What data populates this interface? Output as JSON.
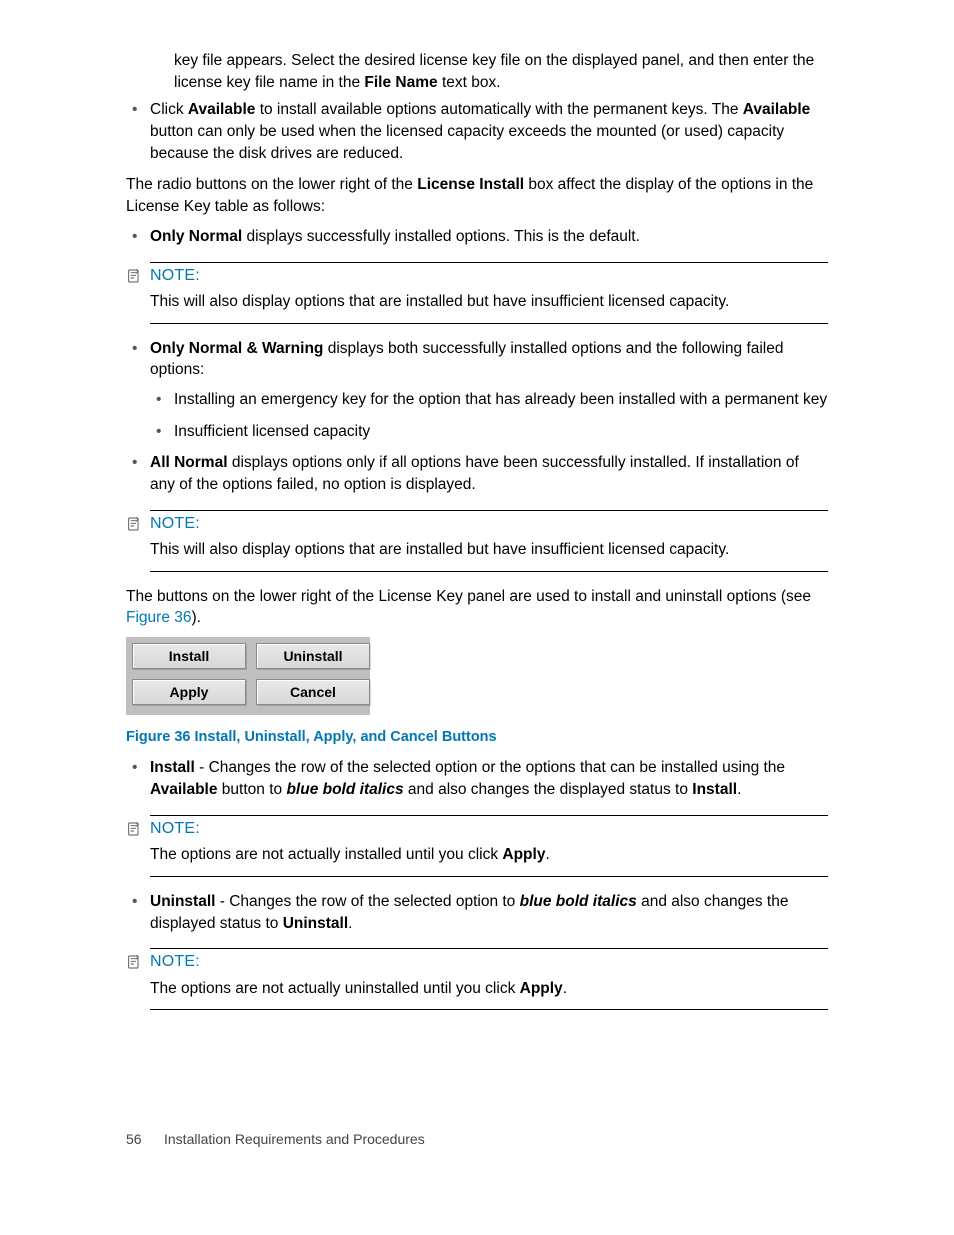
{
  "intro": {
    "frag1": "key file appears. Select the desired license key file on the displayed panel, and then enter the license key file name in the ",
    "frag1_bold": "File Name",
    "frag1_after": " text box.",
    "click_li_pre": "Click ",
    "click_li_b1": "Available",
    "click_li_mid": " to install available options automatically with the permanent keys. The ",
    "click_li_b2": "Available",
    "click_li_end": " button can only be used when the licensed capacity exceeds the mounted (or used) capacity because the disk drives are reduced."
  },
  "radio_intro_pre": "The radio buttons on the lower right of the ",
  "radio_intro_b": "License Install",
  "radio_intro_post": " box affect the display of the options in the License Key table as follows:",
  "only_normal": {
    "b": "Only Normal",
    "t": " displays successfully installed options. This is the default."
  },
  "note1": {
    "label": "NOTE:",
    "body": "This will also display options that are installed but have insufficient licensed capacity."
  },
  "only_nw": {
    "b": "Only Normal & Warning",
    "t": " displays both successfully installed options and the following failed options:",
    "sub1": "Installing an emergency key for the option that has already been installed with a permanent key",
    "sub2": "Insufficient licensed capacity"
  },
  "all_normal": {
    "b": "All Normal",
    "t": " displays options only if all options have been successfully installed. If installation of any of the options failed, no option is displayed."
  },
  "note2": {
    "label": "NOTE:",
    "body": "This will also display options that are installed but have insufficient licensed capacity."
  },
  "buttons_intro_pre": "The buttons on the lower right of the License Key panel are used to install and uninstall options (see ",
  "buttons_intro_link": "Figure 36",
  "buttons_intro_post": ").",
  "figbuttons": {
    "install": "Install",
    "uninstall": "Uninstall",
    "apply": "Apply",
    "cancel": "Cancel"
  },
  "fig_caption": "Figure 36 Install, Uninstall, Apply, and Cancel Buttons",
  "install_li": {
    "b": "Install",
    "t1": " - Changes the row of the selected option or the options that can be installed using the ",
    "b2": "Available",
    "t2": " button to ",
    "bi": "blue bold italics",
    "t3": " and also changes the displayed status to ",
    "b3": "Install",
    "t4": "."
  },
  "note3": {
    "label": "NOTE:",
    "body_pre": "The options are not actually installed until you click ",
    "body_b": "Apply",
    "body_post": "."
  },
  "uninstall_li": {
    "b": "Uninstall",
    "t1": " - Changes the row of the selected option to ",
    "bi": "blue bold italics",
    "t2": " and also changes the displayed status to ",
    "b2": "Uninstall",
    "t3": "."
  },
  "note4": {
    "label": "NOTE:",
    "body_pre": "The options are not actually uninstalled until you click ",
    "body_b": "Apply",
    "body_post": "."
  },
  "footer": {
    "page": "56",
    "title": "Installation Requirements and Procedures"
  }
}
